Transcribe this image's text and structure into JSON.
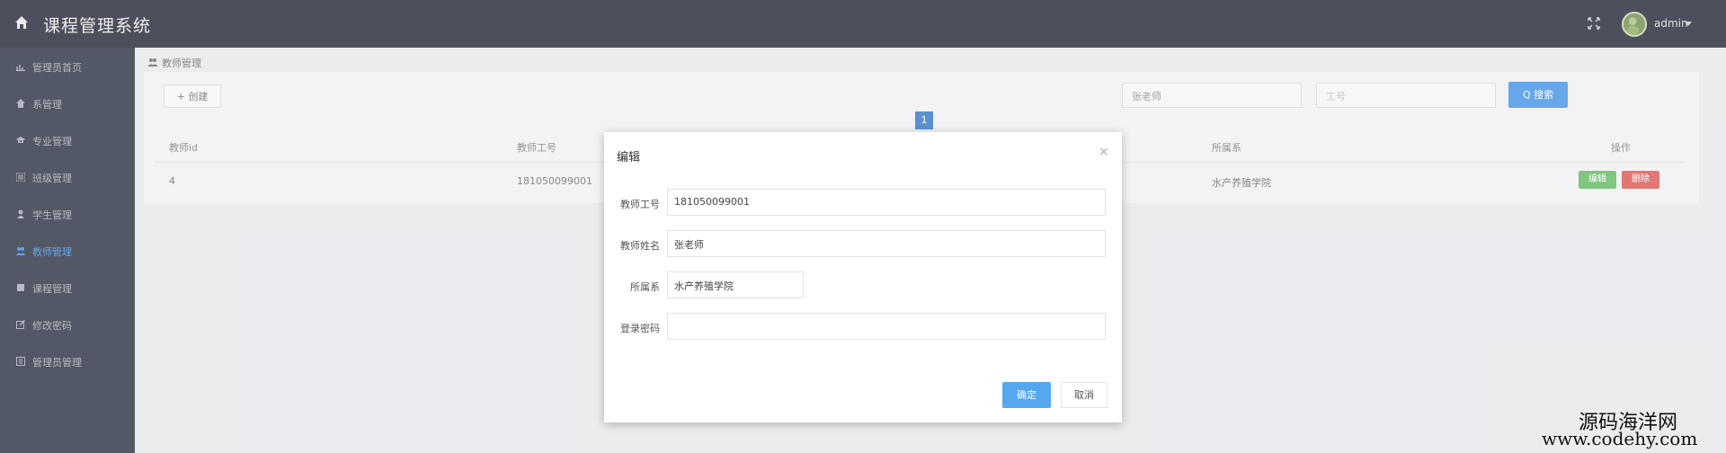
{
  "header": {
    "app_title": "课程管理系统",
    "user": "admin"
  },
  "sidebar": {
    "items": [
      {
        "label": "管理员首页",
        "icon": "chart-icon"
      },
      {
        "label": "系管理",
        "icon": "home-icon"
      },
      {
        "label": "专业管理",
        "icon": "graduation-icon"
      },
      {
        "label": "班级管理",
        "icon": "list-icon"
      },
      {
        "label": "学生管理",
        "icon": "user-icon"
      },
      {
        "label": "教师管理",
        "icon": "users-icon",
        "active": true
      },
      {
        "label": "课程管理",
        "icon": "book-icon"
      },
      {
        "label": "修改密码",
        "icon": "edit-icon"
      },
      {
        "label": "管理员管理",
        "icon": "admin-icon"
      }
    ]
  },
  "breadcrumb": {
    "label": "教师管理"
  },
  "toolbar": {
    "create_label": "+ 创建",
    "search_name_value": "张老师",
    "search_field2_placeholder": "工号",
    "search_label": "Q 搜索"
  },
  "pagination": {
    "current": "1"
  },
  "table": {
    "headers": [
      "教师id",
      "教师工号",
      "所属系",
      "操作"
    ],
    "rows": [
      {
        "id": "4",
        "number": "181050099001",
        "department": "水产养殖学院",
        "edit": "编辑",
        "delete": "删除"
      }
    ]
  },
  "modal": {
    "title": "编辑",
    "fields": [
      {
        "label": "教师工号",
        "value": "181050099001"
      },
      {
        "label": "教师姓名",
        "value": "张老师"
      },
      {
        "label": "所属系",
        "value": "水产养殖学院"
      },
      {
        "label": "登录密码",
        "value": ""
      }
    ],
    "ok_label": "确定",
    "cancel_label": "取消"
  },
  "watermark": {
    "line1": "源码海洋网",
    "line2": "www.codehy.com"
  },
  "colors": {
    "topbar": "#1b1f2f",
    "sidebar": "#232a3b",
    "primary": "#3d8de2",
    "success": "#5cb85c",
    "danger": "#d9534f"
  }
}
